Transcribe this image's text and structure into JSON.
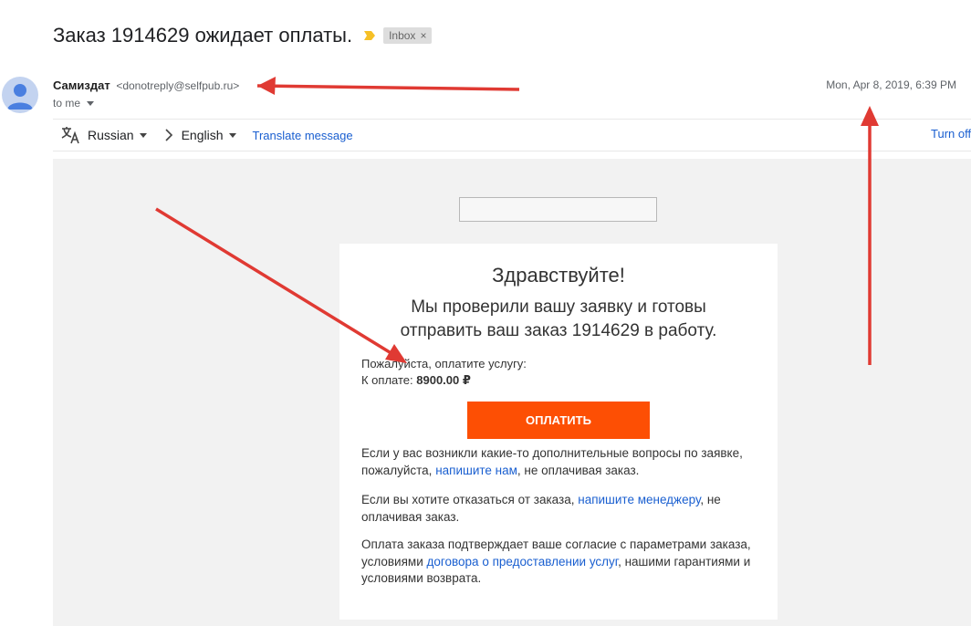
{
  "email": {
    "subject": "Заказ 1914629 ожидает оплаты.",
    "label": "Inbox",
    "label_close": "×",
    "sender_name": "Самиздат",
    "sender_email": "<donotreply@selfpub.ru>",
    "to": "to me",
    "date": "Mon, Apr 8, 2019, 6:39 PM"
  },
  "translate": {
    "from_lang": "Russian",
    "to_lang": "English",
    "translate_link": "Translate message",
    "turn_off": "Turn off"
  },
  "body": {
    "greeting": "Здравствуйте!",
    "lead": "Мы проверили вашу заявку и готовы отправить ваш заказ 1914629 в работу.",
    "pay_request": "Пожалуйста, оплатите услугу:",
    "to_pay_label": "К оплате:",
    "to_pay_amount": "8900.00 ₽",
    "pay_button": "ОПЛАТИТЬ",
    "p1_a": "Если у вас возникли какие-то дополнительные вопросы по заявке, пожалуйста,",
    "p1_link": "напишите нам",
    "p1_b": ", не оплачивая заказ.",
    "p2_a": "Если вы хотите отказаться от заказа,",
    "p2_link": "напишите менеджеру",
    "p2_b": ", не оплачивая заказ.",
    "p3_a": "Оплата заказа подтверждает ваше согласие с параметрами заказа, условиями",
    "p3_link": "договора о предоставлении услуг",
    "p3_b": ", нашими гарантиями и условиями возврата."
  },
  "colors": {
    "pay_button": "#fd4f04",
    "link": "#1a5fd0",
    "annotation_arrow": "#e03a33",
    "importance_marker": "#f6c026"
  },
  "icons": [
    "importance-marker-icon",
    "avatar-person-icon",
    "translate-icon",
    "chevron-right-icon",
    "caret-down-icon"
  ]
}
